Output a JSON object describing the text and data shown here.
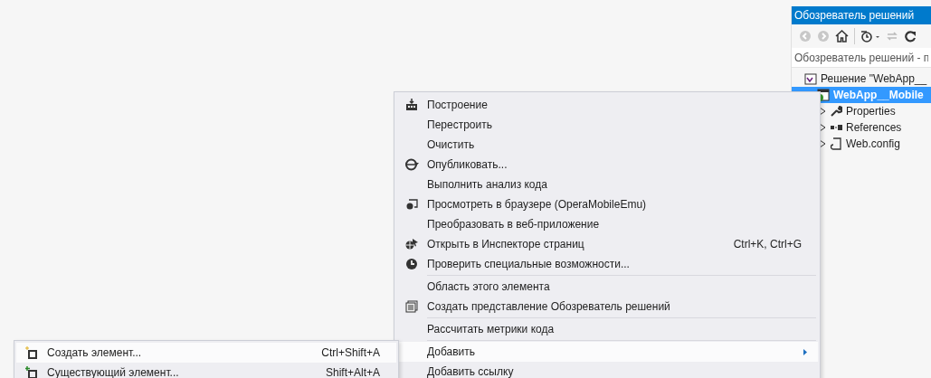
{
  "solution_explorer": {
    "title": "Обозреватель решений",
    "search": {
      "placeholder": "Обозреватель решений - п"
    },
    "tree": [
      {
        "label": "Решение \"WebApp__",
        "kind": "solution",
        "selected": false,
        "children": [
          {
            "label": "WebApp__Mobile",
            "kind": "project",
            "selected": true,
            "children": [
              {
                "label": "Properties",
                "kind": "properties",
                "selected": false,
                "expanded": false
              },
              {
                "label": "References",
                "kind": "references",
                "selected": false,
                "expanded": false
              },
              {
                "label": "Web.config",
                "kind": "config",
                "selected": false,
                "expanded": false
              }
            ]
          }
        ]
      }
    ]
  },
  "context_menu": {
    "items": [
      {
        "kind": "build",
        "label": "Построение",
        "selected": false
      },
      {
        "kind": "plain",
        "label": "Перестроить",
        "selected": false
      },
      {
        "kind": "plain",
        "label": "Очистить",
        "selected": false
      },
      {
        "kind": "publish",
        "label": "Опубликовать...",
        "selected": false
      },
      {
        "kind": "plain",
        "label": "Выполнить анализ кода",
        "selected": false
      },
      {
        "kind": "browser",
        "label": "Просмотреть в браузере (OperaMobileEmu)",
        "selected": false
      },
      {
        "kind": "plain",
        "label": "Преобразовать в веб-приложение",
        "selected": false
      },
      {
        "kind": "inspector",
        "label": "Открыть в Инспекторе страниц",
        "shortcut": "Ctrl+K, Ctrl+G",
        "selected": false
      },
      {
        "kind": "accessibility",
        "label": "Проверить специальные возможности...",
        "selected": false
      },
      {
        "kind": "separator"
      },
      {
        "kind": "plain",
        "label": "Область этого элемента",
        "selected": false
      },
      {
        "kind": "view",
        "label": "Создать представление Обозреватель решений",
        "selected": false
      },
      {
        "kind": "separator"
      },
      {
        "kind": "plain",
        "label": "Рассчитать метрики кода",
        "selected": false
      },
      {
        "kind": "separator"
      },
      {
        "kind": "submenu",
        "label": "Добавить",
        "selected": true
      },
      {
        "kind": "plain",
        "label": "Добавить ссылку",
        "selected": false
      }
    ]
  },
  "submenu": {
    "items": [
      {
        "kind": "new",
        "label": "Создать элемент...",
        "shortcut": "Ctrl+Shift+A",
        "selected": true
      },
      {
        "kind": "existing",
        "label": "Существующий элемент...",
        "shortcut": "Shift+Alt+A",
        "selected": false
      }
    ]
  }
}
